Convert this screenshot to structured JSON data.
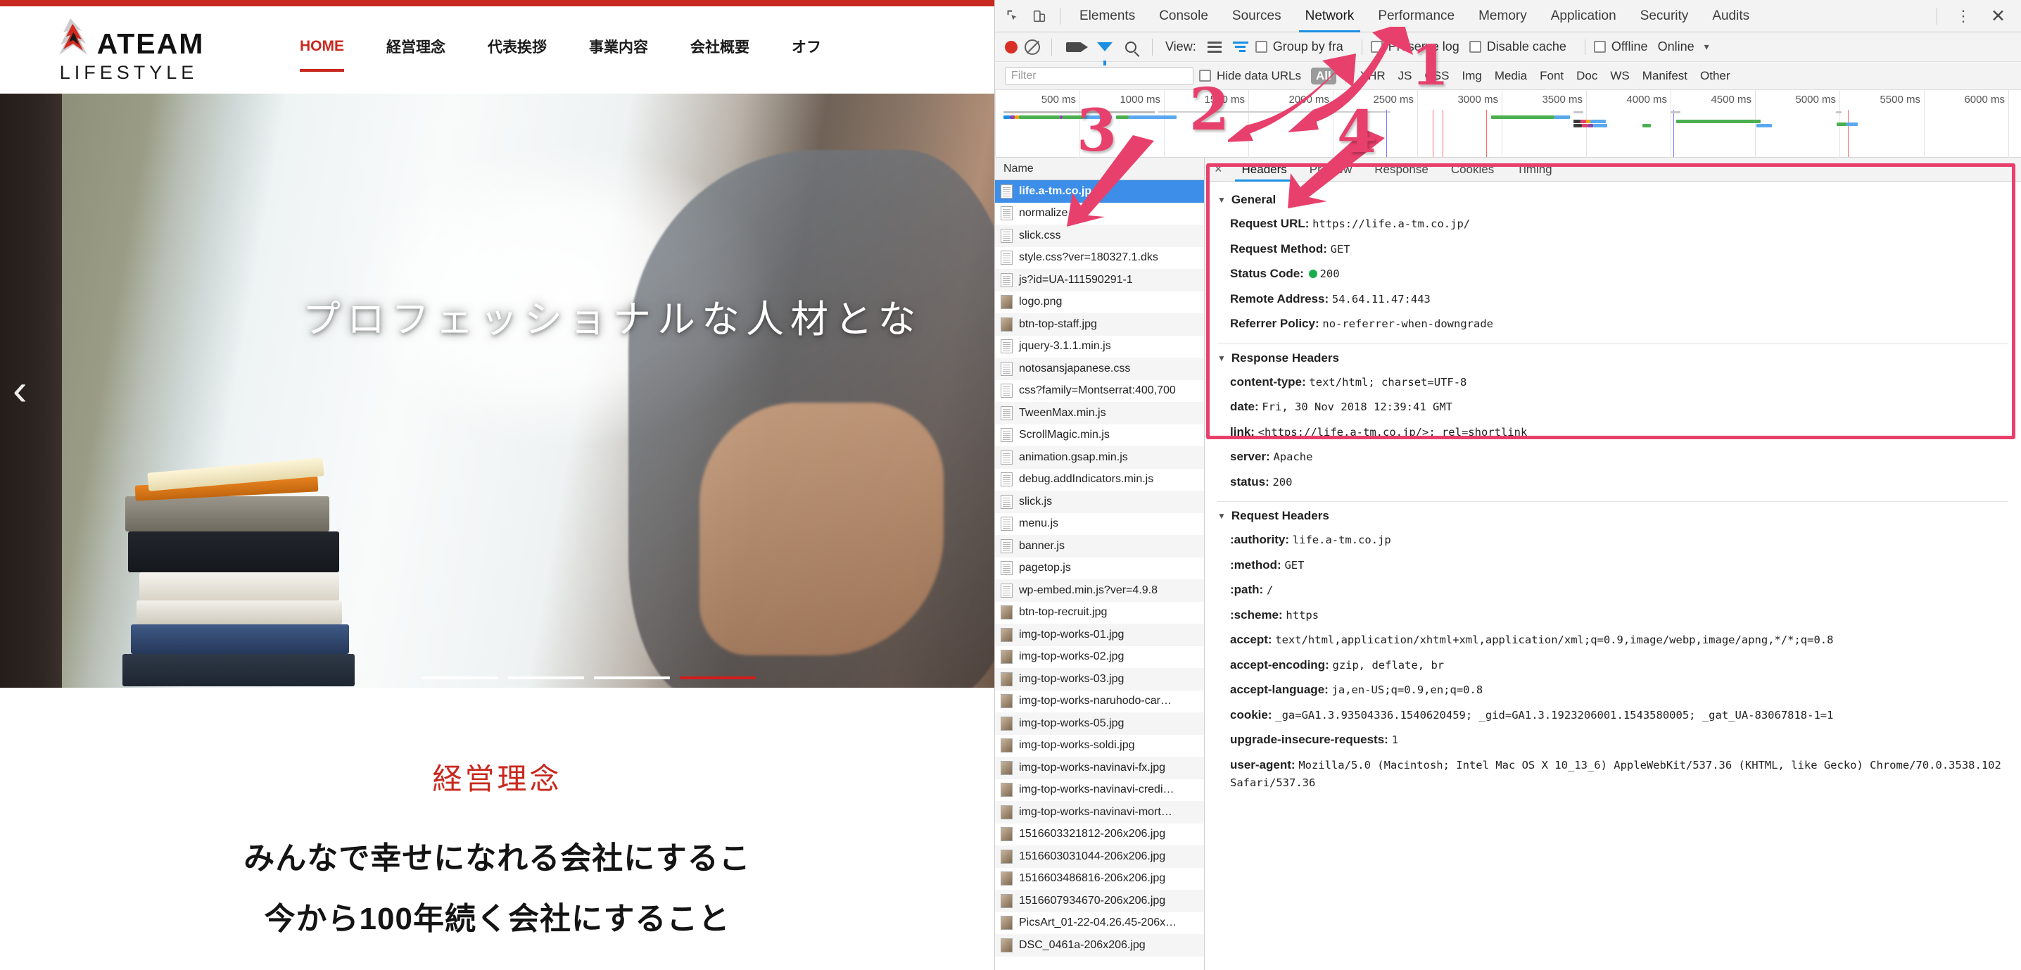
{
  "website": {
    "brand": {
      "name": "ATEAM",
      "sub": "LIFESTYLE",
      "logo_icon": "flame-a-logo-icon"
    },
    "nav": [
      {
        "label": "HOME",
        "active": true
      },
      {
        "label": "経営理念",
        "active": false
      },
      {
        "label": "代表挨拶",
        "active": false
      },
      {
        "label": "事業内容",
        "active": false
      },
      {
        "label": "会社概要",
        "active": false
      },
      {
        "label": "オフ",
        "active": false
      }
    ],
    "hero": {
      "headline": "プロフェッショナルな人材とな",
      "prev_arrow": "‹",
      "slides": 4,
      "active_slide": 4
    },
    "section": {
      "title": "経営理念",
      "line1": "みんなで幸せになれる会社にするこ",
      "line2": "今から100年続く会社にすること"
    },
    "colors": {
      "brand_red": "#c8281e",
      "accent_blue": "#1a8fe3"
    }
  },
  "devtools": {
    "panel_tabs": [
      {
        "label": "Elements",
        "active": false
      },
      {
        "label": "Console",
        "active": false
      },
      {
        "label": "Sources",
        "active": false
      },
      {
        "label": "Network",
        "active": true
      },
      {
        "label": "Performance",
        "active": false
      },
      {
        "label": "Memory",
        "active": false
      },
      {
        "label": "Application",
        "active": false
      },
      {
        "label": "Security",
        "active": false
      },
      {
        "label": "Audits",
        "active": false
      }
    ],
    "toolbar": {
      "record_icon": "record-dot-icon",
      "clear_icon": "clear-icon",
      "capture_screenshots_icon": "camera-icon",
      "filter_icon": "funnel-icon",
      "search_icon": "search-icon",
      "view_label": "View:",
      "view_list_icon": "list-view-icon",
      "view_waterfall_icon": "waterfall-view-icon",
      "group_by_frame": "Group by fra",
      "preserve_log": "Preserve log",
      "disable_cache": "Disable cache",
      "offline": "Offline",
      "throttling": "Online",
      "throttling_caret": "▾"
    },
    "filterbar": {
      "filter_placeholder": "Filter",
      "hide_data_urls": "Hide data URLs",
      "types": [
        {
          "label": "All",
          "active": true
        },
        {
          "label": "XHR",
          "active": false
        },
        {
          "label": "JS",
          "active": false
        },
        {
          "label": "CSS",
          "active": false
        },
        {
          "label": "Img",
          "active": false
        },
        {
          "label": "Media",
          "active": false
        },
        {
          "label": "Font",
          "active": false
        },
        {
          "label": "Doc",
          "active": false
        },
        {
          "label": "WS",
          "active": false
        },
        {
          "label": "Manifest",
          "active": false
        },
        {
          "label": "Other",
          "active": false
        }
      ]
    },
    "overview": {
      "ticks": [
        "500 ms",
        "1000 ms",
        "1500 ms",
        "2000 ms",
        "2500 ms",
        "3000 ms",
        "3500 ms",
        "4000 ms",
        "4500 ms",
        "5000 ms",
        "5500 ms",
        "6000 ms"
      ]
    },
    "requests": {
      "column_header": "Name",
      "rows": [
        {
          "name": "life.a-tm.co.jp",
          "kind": "doc",
          "selected": true
        },
        {
          "name": "normalize.css",
          "kind": "doc",
          "selected": false
        },
        {
          "name": "slick.css",
          "kind": "doc",
          "selected": false
        },
        {
          "name": "style.css?ver=180327.1.dks",
          "kind": "doc",
          "selected": false
        },
        {
          "name": "js?id=UA-111590291-1",
          "kind": "doc",
          "selected": false
        },
        {
          "name": "logo.png",
          "kind": "img",
          "selected": false
        },
        {
          "name": "btn-top-staff.jpg",
          "kind": "img",
          "selected": false
        },
        {
          "name": "jquery-3.1.1.min.js",
          "kind": "doc",
          "selected": false
        },
        {
          "name": "notosansjapanese.css",
          "kind": "doc",
          "selected": false
        },
        {
          "name": "css?family=Montserrat:400,700",
          "kind": "doc",
          "selected": false
        },
        {
          "name": "TweenMax.min.js",
          "kind": "doc",
          "selected": false
        },
        {
          "name": "ScrollMagic.min.js",
          "kind": "doc",
          "selected": false
        },
        {
          "name": "animation.gsap.min.js",
          "kind": "doc",
          "selected": false
        },
        {
          "name": "debug.addIndicators.min.js",
          "kind": "doc",
          "selected": false
        },
        {
          "name": "slick.js",
          "kind": "doc",
          "selected": false
        },
        {
          "name": "menu.js",
          "kind": "doc",
          "selected": false
        },
        {
          "name": "banner.js",
          "kind": "doc",
          "selected": false
        },
        {
          "name": "pagetop.js",
          "kind": "doc",
          "selected": false
        },
        {
          "name": "wp-embed.min.js?ver=4.9.8",
          "kind": "doc",
          "selected": false
        },
        {
          "name": "btn-top-recruit.jpg",
          "kind": "img",
          "selected": false
        },
        {
          "name": "img-top-works-01.jpg",
          "kind": "img",
          "selected": false
        },
        {
          "name": "img-top-works-02.jpg",
          "kind": "img",
          "selected": false
        },
        {
          "name": "img-top-works-03.jpg",
          "kind": "img",
          "selected": false
        },
        {
          "name": "img-top-works-naruhodo-car…",
          "kind": "img",
          "selected": false
        },
        {
          "name": "img-top-works-05.jpg",
          "kind": "img",
          "selected": false
        },
        {
          "name": "img-top-works-soldi.jpg",
          "kind": "img",
          "selected": false
        },
        {
          "name": "img-top-works-navinavi-fx.jpg",
          "kind": "img",
          "selected": false
        },
        {
          "name": "img-top-works-navinavi-credi…",
          "kind": "img",
          "selected": false
        },
        {
          "name": "img-top-works-navinavi-mort…",
          "kind": "img",
          "selected": false
        },
        {
          "name": "1516603321812-206x206.jpg",
          "kind": "img",
          "selected": false
        },
        {
          "name": "1516603031044-206x206.jpg",
          "kind": "img",
          "selected": false
        },
        {
          "name": "1516603486816-206x206.jpg",
          "kind": "img",
          "selected": false
        },
        {
          "name": "1516607934670-206x206.jpg",
          "kind": "img",
          "selected": false
        },
        {
          "name": "PicsArt_01-22-04.26.45-206x…",
          "kind": "img",
          "selected": false
        },
        {
          "name": "DSC_0461a-206x206.jpg",
          "kind": "img",
          "selected": false
        }
      ]
    },
    "details": {
      "close_icon": "×",
      "tabs": [
        {
          "label": "Headers",
          "active": true
        },
        {
          "label": "Preview",
          "active": false
        },
        {
          "label": "Response",
          "active": false
        },
        {
          "label": "Cookies",
          "active": false
        },
        {
          "label": "Timing",
          "active": false
        }
      ],
      "general": {
        "title": "General",
        "items": [
          {
            "key": "Request URL:",
            "value": "https://life.a-tm.co.jp/"
          },
          {
            "key": "Request Method:",
            "value": "GET"
          },
          {
            "key": "Status Code:",
            "value": "200",
            "dot": "green"
          },
          {
            "key": "Remote Address:",
            "value": "54.64.11.47:443"
          },
          {
            "key": "Referrer Policy:",
            "value": "no-referrer-when-downgrade"
          }
        ]
      },
      "response_headers": {
        "title": "Response Headers",
        "items": [
          {
            "key": "content-type:",
            "value": "text/html; charset=UTF-8"
          },
          {
            "key": "date:",
            "value": "Fri, 30 Nov 2018 12:39:41 GMT"
          },
          {
            "key": "link:",
            "value": "<https://life.a-tm.co.jp/>; rel=shortlink"
          },
          {
            "key": "server:",
            "value": "Apache"
          },
          {
            "key": "status:",
            "value": "200"
          }
        ]
      },
      "request_headers": {
        "title": "Request Headers",
        "items": [
          {
            "key": ":authority:",
            "value": "life.a-tm.co.jp"
          },
          {
            "key": ":method:",
            "value": "GET"
          },
          {
            "key": ":path:",
            "value": "/"
          },
          {
            "key": ":scheme:",
            "value": "https"
          },
          {
            "key": "accept:",
            "value": "text/html,application/xhtml+xml,application/xml;q=0.9,image/webp,image/apng,*/*;q=0.8"
          },
          {
            "key": "accept-encoding:",
            "value": "gzip, deflate, br"
          },
          {
            "key": "accept-language:",
            "value": "ja,en-US;q=0.9,en;q=0.8"
          },
          {
            "key": "cookie:",
            "value": "_ga=GA1.3.93504336.1540620459; _gid=GA1.3.1923206001.1543580005; _gat_UA-83067818-1=1"
          },
          {
            "key": "upgrade-insecure-requests:",
            "value": "1"
          },
          {
            "key": "user-agent:",
            "value": "Mozilla/5.0 (Macintosh; Intel Mac OS X 10_13_6) AppleWebKit/537.36 (KHTML, like Gecko) Chrome/70.0.3538.102 Safari/537.36"
          }
        ]
      }
    },
    "annotations": [
      {
        "number": "1",
        "target": "network-tab"
      },
      {
        "number": "2",
        "target": "all-filter"
      },
      {
        "number": "3",
        "target": "selected-request"
      },
      {
        "number": "4",
        "target": "headers-tab"
      }
    ]
  }
}
